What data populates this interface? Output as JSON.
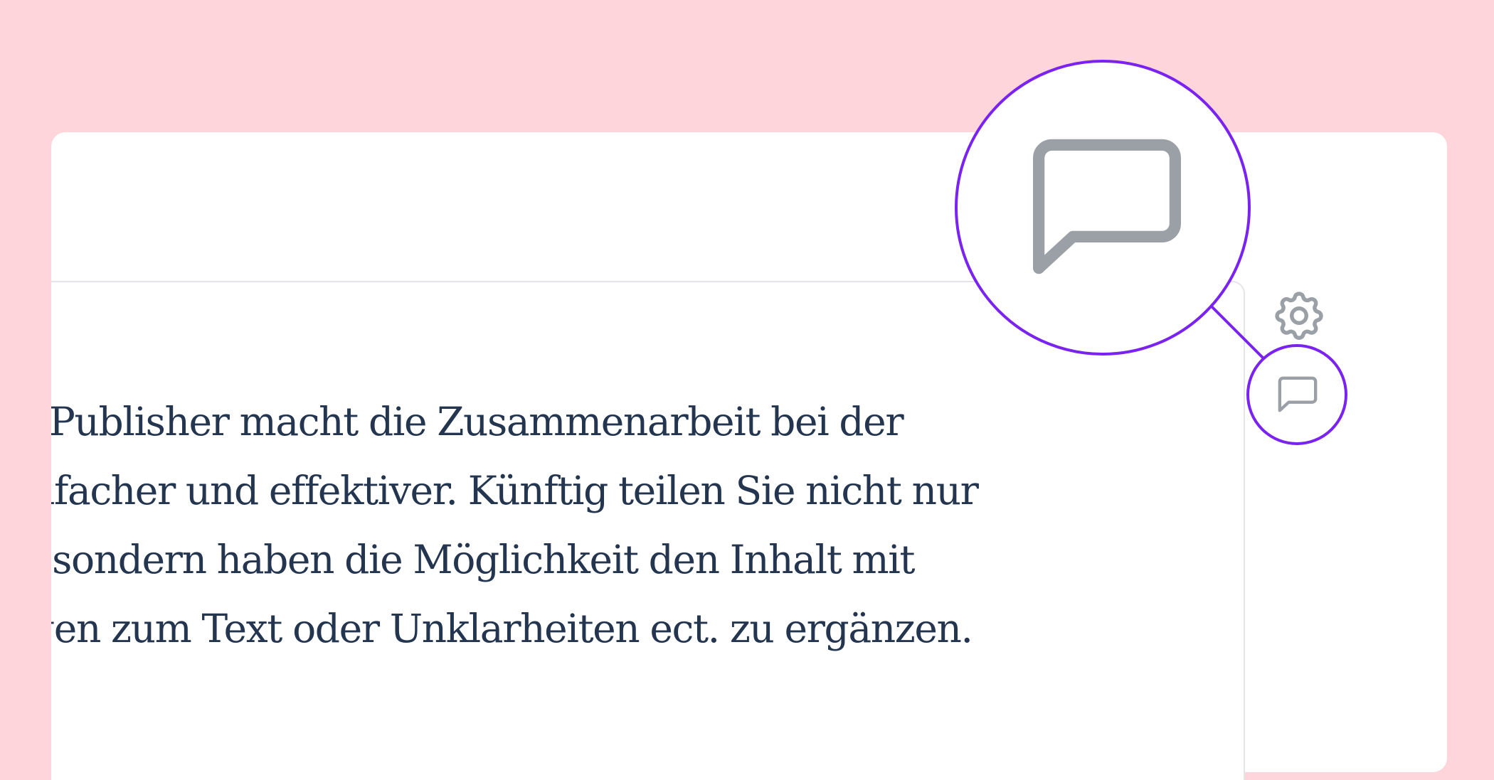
{
  "editor": {
    "paragraph_lines": [
      "sPublisher macht die Zusammenarbeit bei der",
      "nfacher und effektiver. Künftig teilen Sie nicht nur",
      ", sondern haben die Möglichkeit den Inhalt mit",
      "gen zum Text oder Unklarheiten ect. zu ergänzen."
    ]
  },
  "sidebar": {
    "icons": [
      "gear-icon",
      "comment-icon"
    ]
  },
  "colors": {
    "background": "#ffd5dc",
    "card": "#ffffff",
    "text": "#243550",
    "icon": "#9aa0a6",
    "highlight": "#7a22f0",
    "border": "#e3e5e8"
  }
}
